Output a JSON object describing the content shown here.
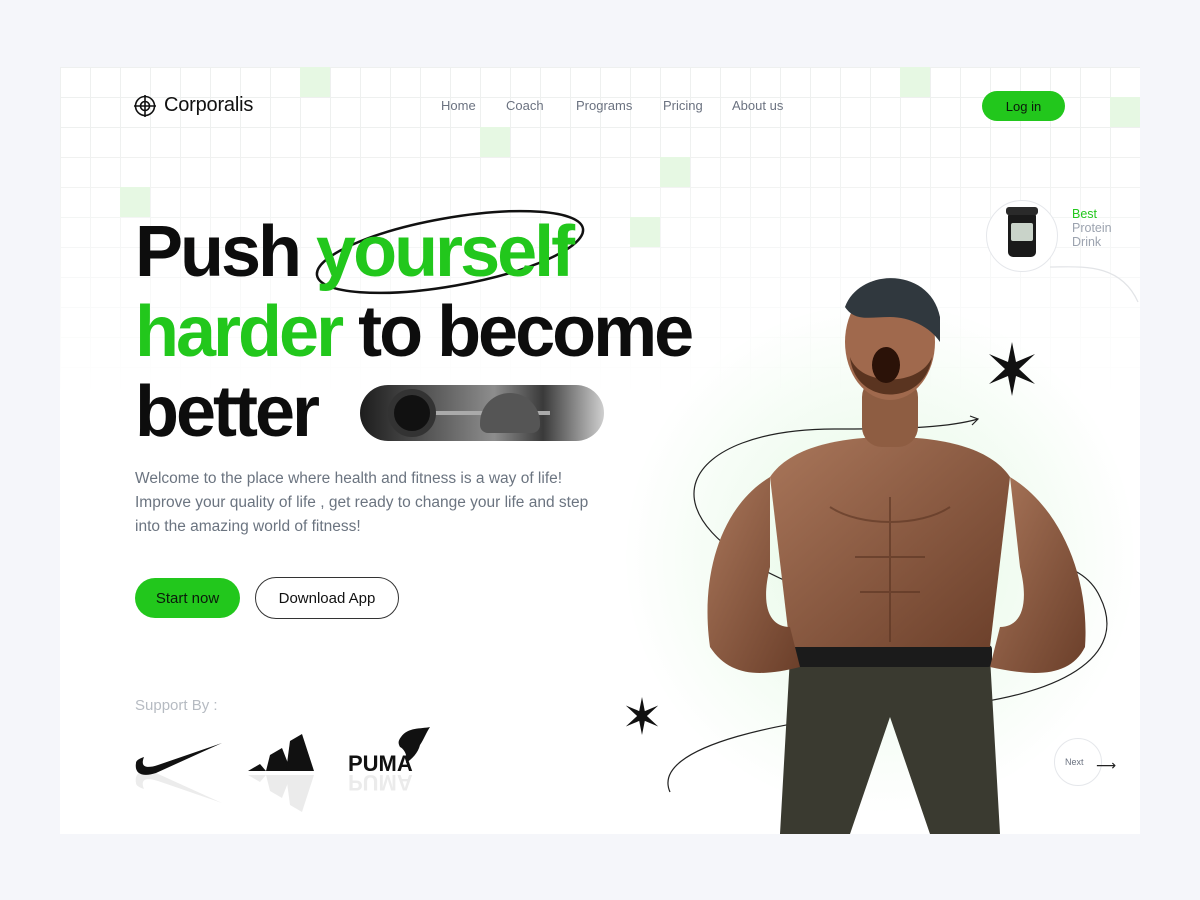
{
  "brand": {
    "name": "Corporalis",
    "logo_icon": "globe-target-icon"
  },
  "nav": {
    "items": [
      "Home",
      "Coach",
      "Programs",
      "Pricing",
      "About us"
    ]
  },
  "header": {
    "login_label": "Log in"
  },
  "hero": {
    "line1_a": "Push",
    "line1_b": "yourself",
    "line2_a": "harder",
    "line2_b": "to become",
    "line3": "better",
    "description": [
      "Welcome to the place where health and fitness is a way of life!",
      "Improve your quality of life , get ready to change your life and step",
      "into the amazing world of fitness!"
    ],
    "start_label": "Start now",
    "download_label": "Download App"
  },
  "support": {
    "label": "Support By :",
    "brands": [
      "nike-logo",
      "adidas-logo",
      "puma-logo"
    ],
    "puma_wordmark": "PUMA"
  },
  "promo": {
    "line1": "Best",
    "line2": "Protein",
    "line3": "Drink"
  },
  "carousel": {
    "next_label": "Next",
    "next_icon": "arrow-right-icon"
  },
  "colors": {
    "accent": "#22c71c",
    "text": "#0d0d0d",
    "muted": "#6b7480",
    "background": "#f5f6fa"
  }
}
